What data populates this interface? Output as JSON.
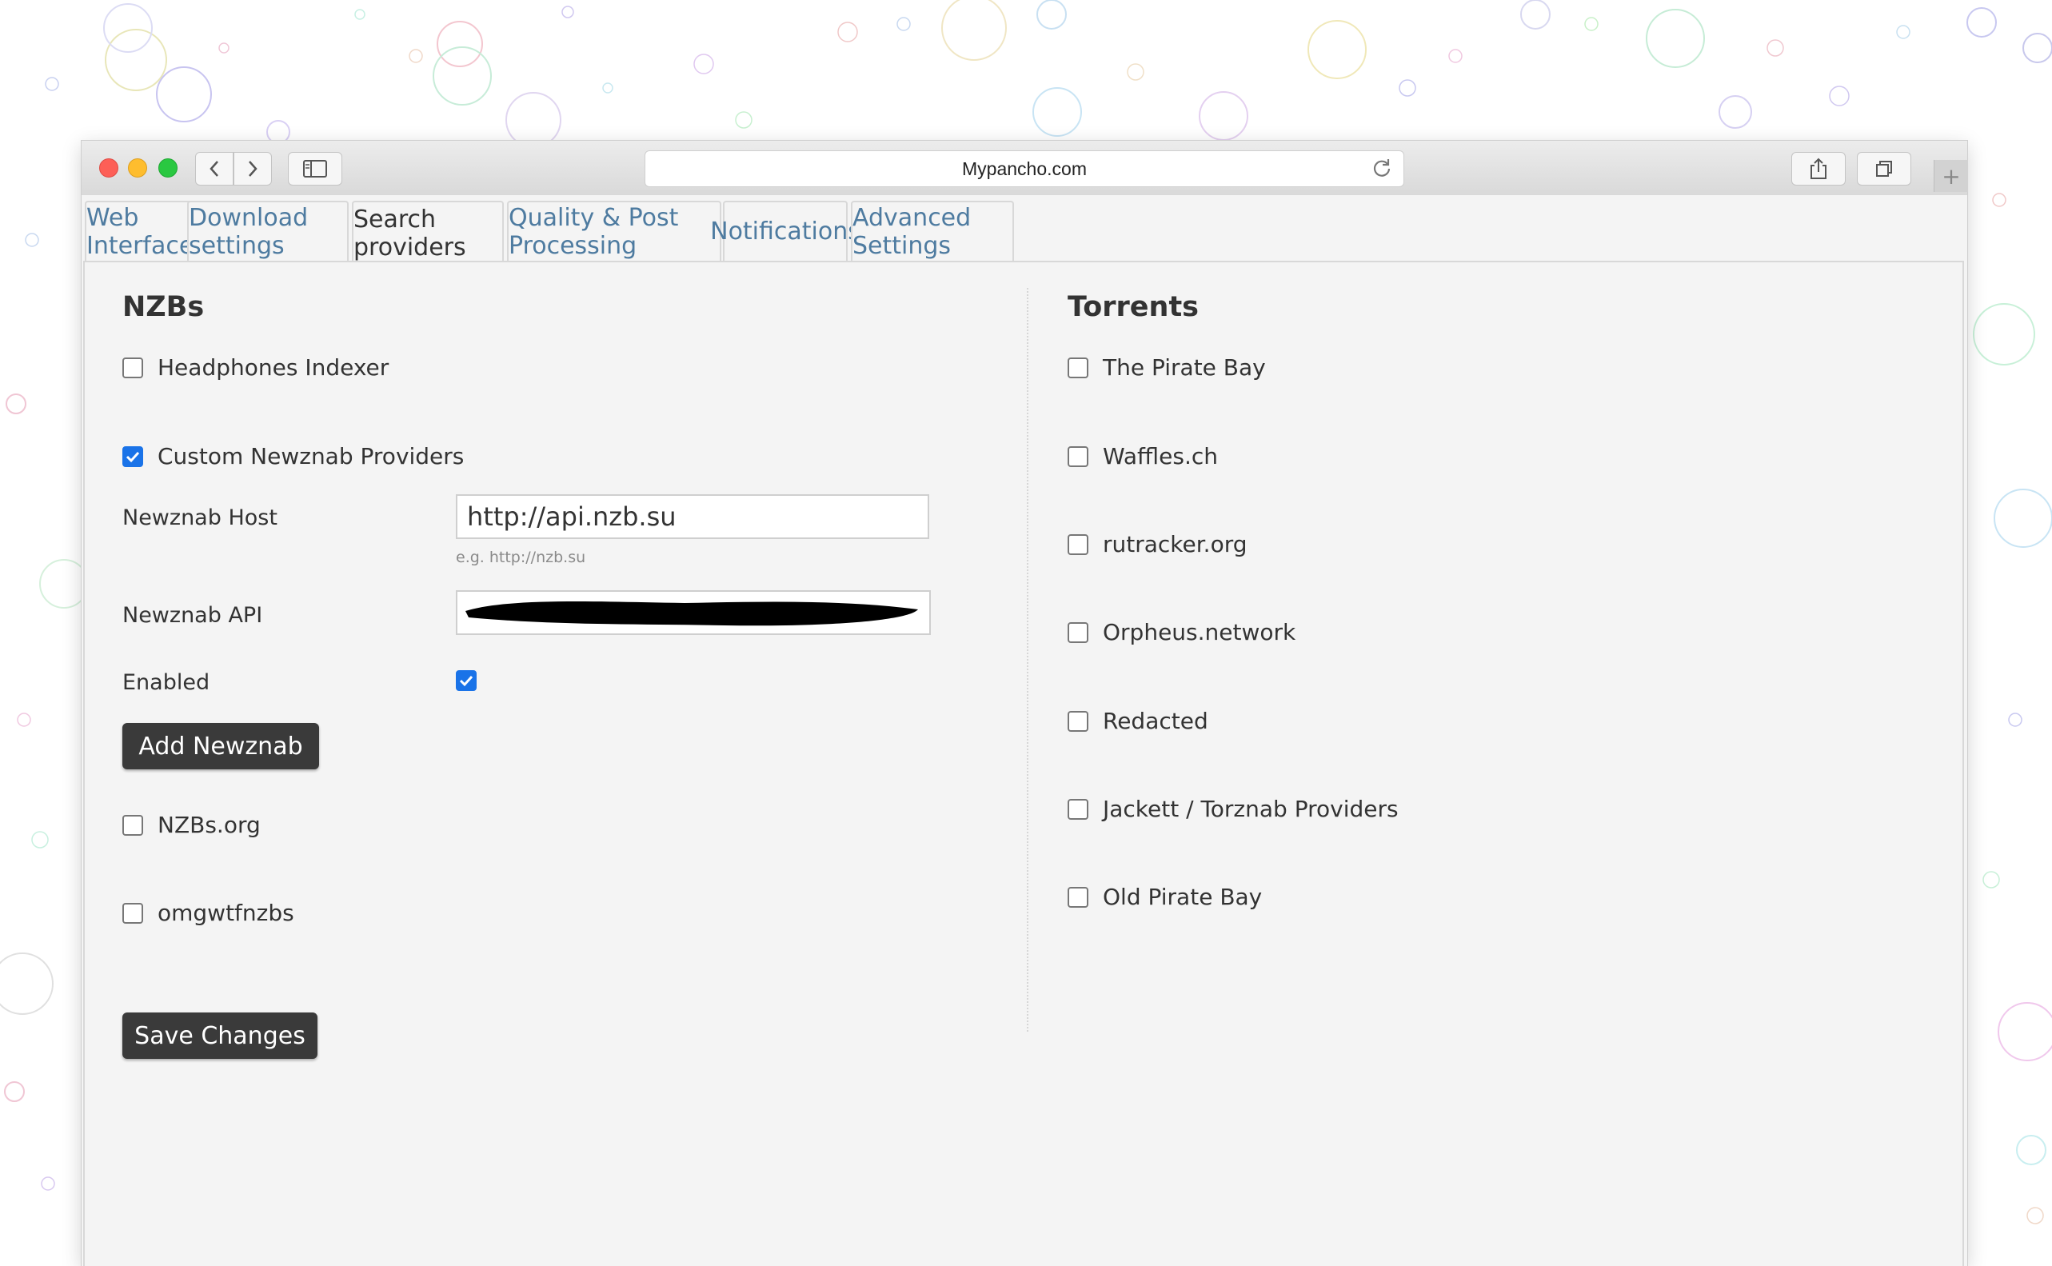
{
  "browser": {
    "url": "Mypancho.com",
    "icons": {
      "back": "chevron-left-icon",
      "forward": "chevron-right-icon",
      "sidebar": "sidebar-icon",
      "reload": "reload-icon",
      "share": "share-icon",
      "tabs": "tabs-icon",
      "new_tab": "plus-icon"
    }
  },
  "tabs": [
    {
      "label": "Web Interface",
      "active": false
    },
    {
      "label": "Download settings",
      "active": false
    },
    {
      "label": "Search providers",
      "active": true
    },
    {
      "label": "Quality & Post Processing",
      "active": false
    },
    {
      "label": "Notifications",
      "active": false
    },
    {
      "label": "Advanced Settings",
      "active": false
    }
  ],
  "nzbs": {
    "heading": "NZBs",
    "headphones": {
      "label": "Headphones Indexer",
      "checked": false
    },
    "custom_newznab": {
      "label": "Custom Newznab Providers",
      "checked": true
    },
    "host": {
      "label": "Newznab Host",
      "value": "http://api.nzb.su",
      "hint": "e.g. http://nzb.su"
    },
    "api": {
      "label": "Newznab API",
      "value": "[redacted]"
    },
    "enabled": {
      "label": "Enabled",
      "checked": true
    },
    "add_button": "Add Newznab",
    "nzbs_org": {
      "label": "NZBs.org",
      "checked": false
    },
    "omgwtfnzbs": {
      "label": "omgwtfnzbs",
      "checked": false
    },
    "save_button": "Save Changes"
  },
  "torrents": {
    "heading": "Torrents",
    "items": [
      {
        "label": "The Pirate Bay",
        "checked": false
      },
      {
        "label": "Waffles.ch",
        "checked": false
      },
      {
        "label": "rutracker.org",
        "checked": false
      },
      {
        "label": "Orpheus.network",
        "checked": false
      },
      {
        "label": "Redacted",
        "checked": false
      },
      {
        "label": "Jackett / Torznab Providers",
        "checked": false
      },
      {
        "label": "Old Pirate Bay",
        "checked": false
      }
    ]
  },
  "colors": {
    "tab_link": "#4e7ba0",
    "button_bg": "#3a3a3a",
    "checkbox_checked": "#1a73e8",
    "panel_bg": "#f4f4f4"
  }
}
